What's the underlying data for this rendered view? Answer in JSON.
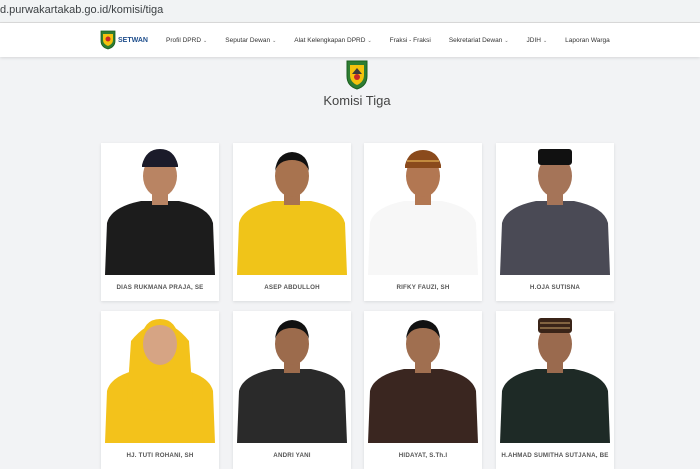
{
  "browser": {
    "url": "d.purwakartakab.go.id/komisi/tiga"
  },
  "navbar": {
    "logo_text": "SETWAN",
    "menu": [
      {
        "label": "Profil DPRD",
        "dropdown": true
      },
      {
        "label": "Seputar Dewan",
        "dropdown": true
      },
      {
        "label": "Alat Kelengkapan DPRD",
        "dropdown": true
      },
      {
        "label": "Fraksi - Fraksi",
        "dropdown": false
      },
      {
        "label": "Sekretariat Dewan",
        "dropdown": true
      },
      {
        "label": "JDIH",
        "dropdown": true
      },
      {
        "label": "Laporan Warga",
        "dropdown": false
      }
    ]
  },
  "page": {
    "title": "Komisi Tiga"
  },
  "members": [
    {
      "name": "DIAS RUKMANA PRAJA, SE",
      "shirt": "#1c1c1c",
      "skin": "#b98463",
      "hair": "#1a1a1a",
      "hat": "blangkon",
      "bg": "#ffffff"
    },
    {
      "name": "ASEP ABDULLOH",
      "shirt": "#f0c419",
      "skin": "#a8734f",
      "hair": "#111111",
      "hat": "none",
      "bg": "#ffffff"
    },
    {
      "name": "RIFKY FAUZI, SH",
      "shirt": "#f7f7f7",
      "skin": "#b27752",
      "hair": "#1a1a1a",
      "hat": "iket",
      "bg": "#ffffff"
    },
    {
      "name": "H.OJA SUTISNA",
      "shirt": "#4a4a55",
      "skin": "#a57458",
      "hair": "#111111",
      "hat": "peci",
      "bg": "#ffffff"
    },
    {
      "name": "HJ. TUTI ROHANI, SH",
      "shirt": "#f3c21b",
      "skin": "#d6a484",
      "hair": "#f3c21b",
      "hat": "hijab",
      "bg": "#ffffff"
    },
    {
      "name": "ANDRI YANI",
      "shirt": "#2a2a2a",
      "skin": "#9c6b4c",
      "hair": "#111111",
      "hat": "none",
      "bg": "#ffffff"
    },
    {
      "name": "HIDAYAT, S.Th.I",
      "shirt": "#3a2620",
      "skin": "#a06f50",
      "hair": "#111111",
      "hat": "none",
      "bg": "#ffffff"
    },
    {
      "name": "H.AHMAD SUMITHA SUTJANA, BE",
      "shirt": "#1e2a26",
      "skin": "#9a6a4e",
      "hair": "#dddddd",
      "hat": "peci-pattern",
      "bg": "#ffffff"
    }
  ],
  "icons": {
    "logo": "regency-crest-icon",
    "caret": "chevron-down-icon"
  }
}
